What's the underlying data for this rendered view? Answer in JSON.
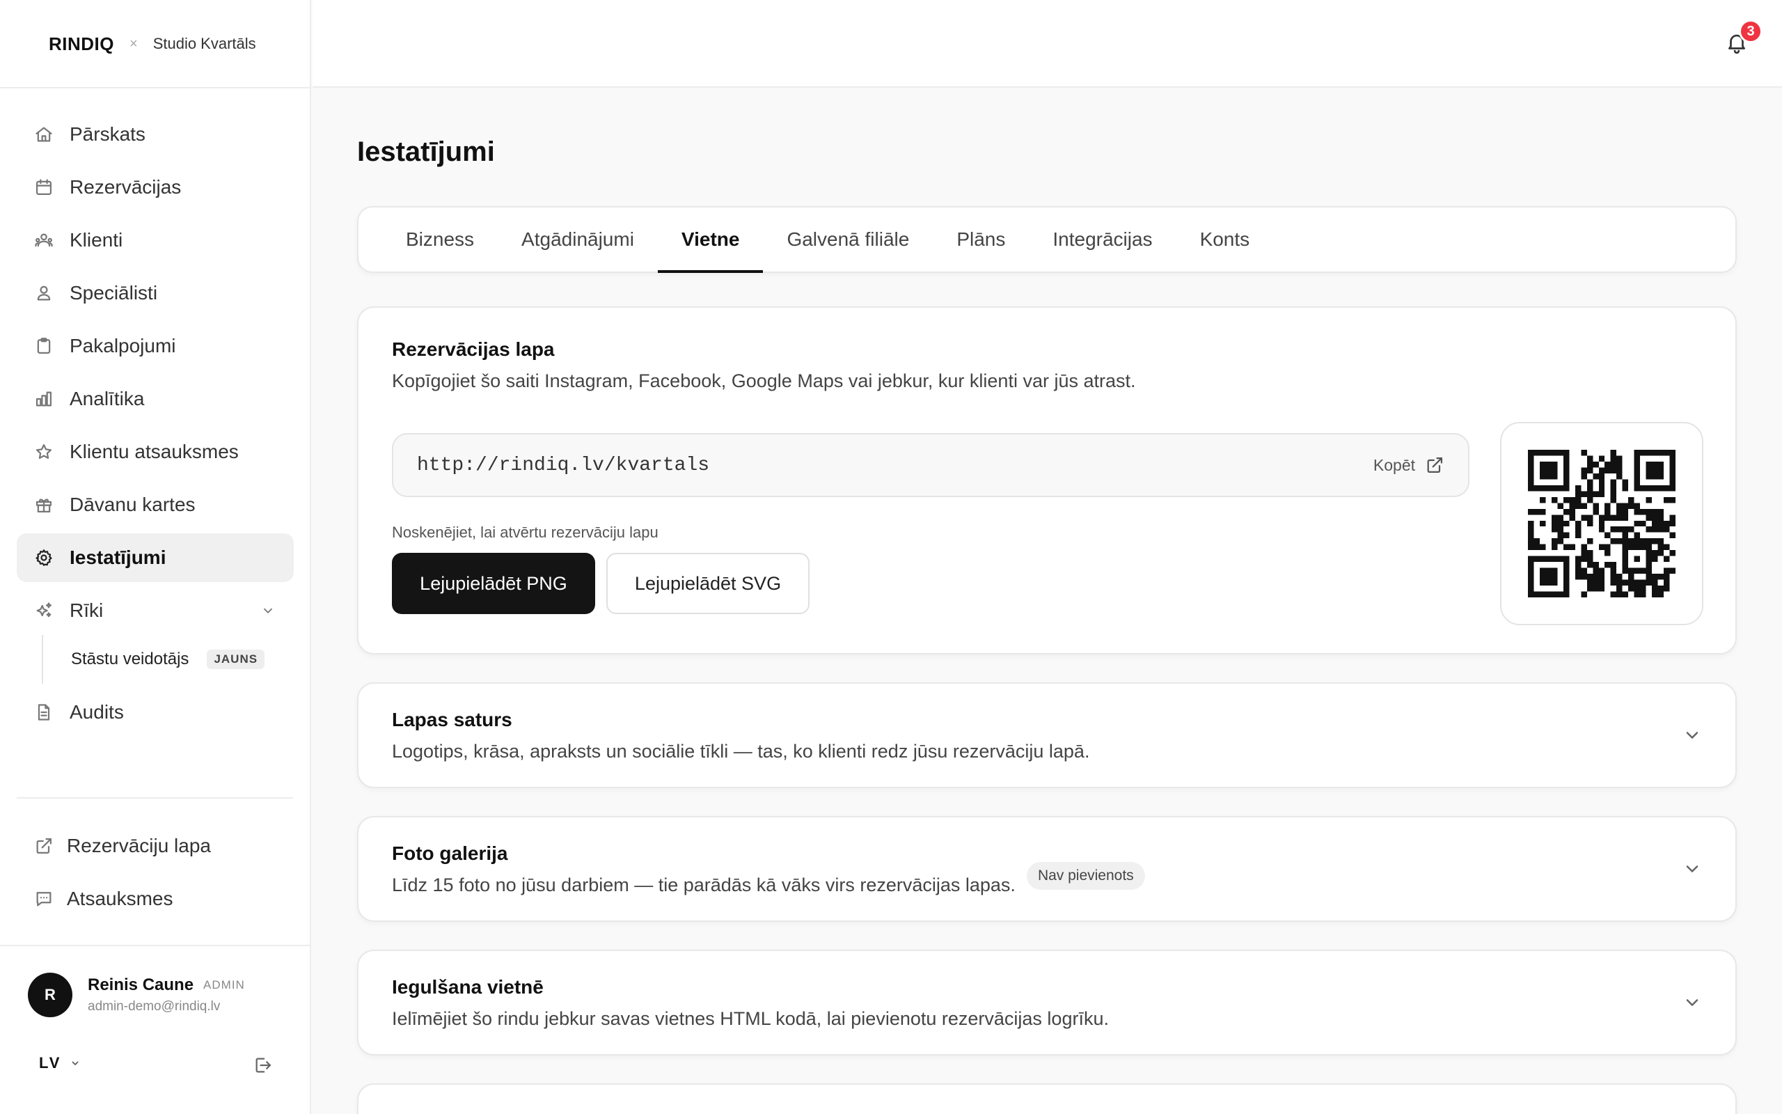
{
  "brand": {
    "logo": "RINDIQ",
    "separator": "×",
    "studio": "Studio Kvartāls"
  },
  "nav": [
    {
      "label": "Pārskats",
      "icon": "home-icon"
    },
    {
      "label": "Rezervācijas",
      "icon": "calendar-icon"
    },
    {
      "label": "Klienti",
      "icon": "users-icon"
    },
    {
      "label": "Speciālisti",
      "icon": "user-icon"
    },
    {
      "label": "Pakalpojumi",
      "icon": "clipboard-icon"
    },
    {
      "label": "Analītika",
      "icon": "bar-chart-icon"
    },
    {
      "label": "Klientu atsauksmes",
      "icon": "star-icon"
    },
    {
      "label": "Dāvanu kartes",
      "icon": "gift-icon"
    },
    {
      "label": "Iestatījumi",
      "icon": "gear-icon",
      "active": true
    },
    {
      "label": "Rīki",
      "icon": "sparkles-icon"
    },
    {
      "label": "Audits",
      "icon": "document-icon"
    }
  ],
  "subnav": {
    "label": "Stāstu veidotājs",
    "badge": "JAUNS"
  },
  "nav_bottom": [
    {
      "label": "Rezervāciju lapa",
      "icon": "external-link-icon"
    },
    {
      "label": "Atsauksmes",
      "icon": "message-icon"
    }
  ],
  "user": {
    "initial": "R",
    "name": "Reinis Caune",
    "role": "ADMIN",
    "email": "admin-demo@rindiq.lv"
  },
  "language": "LV",
  "notifications": {
    "count": "3"
  },
  "page": {
    "title": "Iestatījumi"
  },
  "tabs": [
    "Bizness",
    "Atgādinājumi",
    "Vietne",
    "Galvenā filiāle",
    "Plāns",
    "Integrācijas",
    "Konts"
  ],
  "active_tab": "Vietne",
  "booking_page": {
    "title": "Rezervācijas lapa",
    "description": "Kopīgojiet šo saiti Instagram, Facebook, Google Maps vai jebkur, kur klienti var jūs atrast.",
    "url": "http://rindiq.lv/kvartals",
    "copy_label": "Kopēt",
    "scan_hint": "Noskenējiet, lai atvērtu rezervāciju lapu",
    "download_png": "Lejupielādēt PNG",
    "download_svg": "Lejupielādēt SVG"
  },
  "sections": [
    {
      "title": "Lapas saturs",
      "description": "Logotips, krāsa, apraksts un sociālie tīkli — tas, ko klienti redz jūsu rezervāciju lapā."
    },
    {
      "title": "Foto galerija",
      "description": "Līdz 15 foto no jūsu darbiem — tie parādās kā vāks virs rezervācijas lapas.",
      "badge": "Nav pievienots"
    },
    {
      "title": "Iegulšana vietnē",
      "description": "Ielīmējiet šo rindu jebkur savas vietnes HTML kodā, lai pievienotu rezervācijas logrīku."
    }
  ]
}
